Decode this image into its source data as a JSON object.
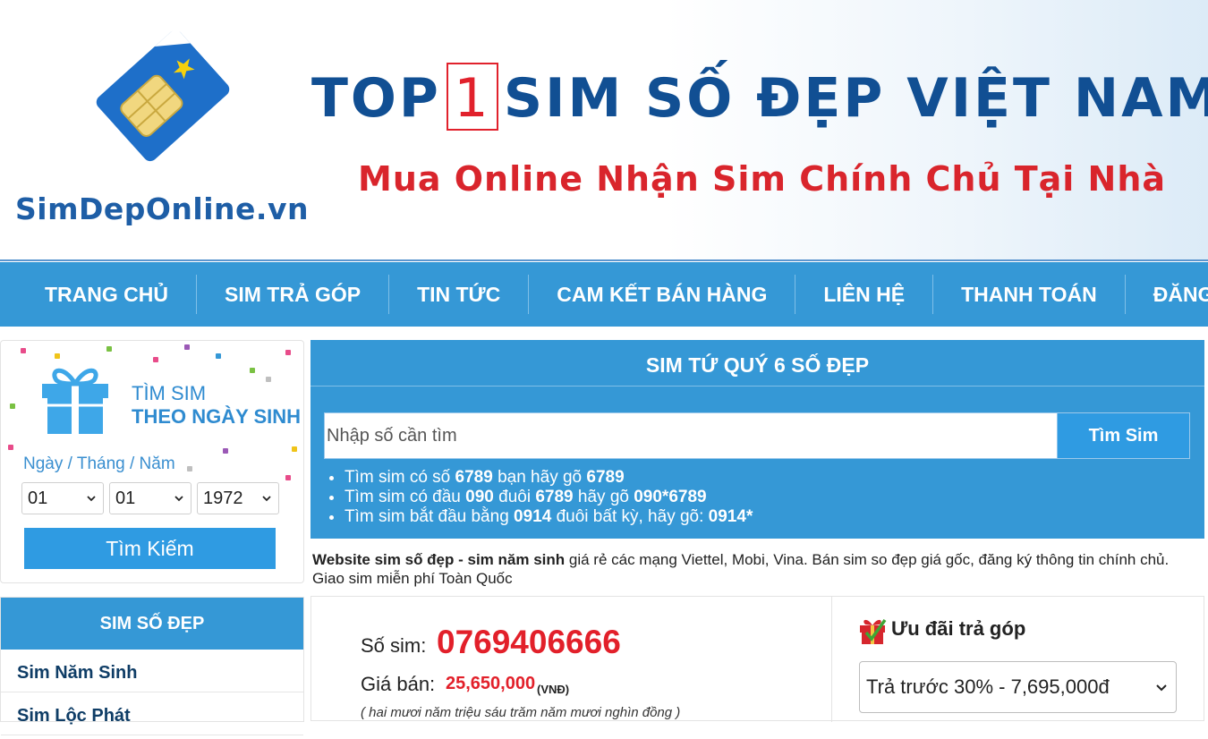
{
  "banner": {
    "site_name": "SimDepOnline.vn",
    "headline_before": "TOP",
    "headline_number": "1",
    "headline_after": "SIM SỐ ĐẸP VIỆT NAM",
    "tagline": "Mua Online Nhận Sim Chính Chủ Tại Nhà"
  },
  "nav": {
    "items": [
      "TRANG CHỦ",
      "SIM TRẢ GÓP",
      "TIN TỨC",
      "CAM KẾT BÁN HÀNG",
      "LIÊN HỆ",
      "THANH TOÁN",
      "ĐĂNG KÝ"
    ]
  },
  "birth_search": {
    "title_line1": "TÌM SIM",
    "title_line2": "THEO NGÀY SINH",
    "date_label": "Ngày / Tháng / Năm",
    "day": "01",
    "month": "01",
    "year": "1972",
    "button": "Tìm Kiếm"
  },
  "categories": {
    "heading": "SIM SỐ ĐẸP",
    "items": [
      "Sim Năm Sinh",
      "Sim Lộc Phát"
    ]
  },
  "main": {
    "title": "SIM TỨ QUÝ 6 SỐ ĐẸP",
    "search_placeholder": "Nhập số cần tìm",
    "search_button": "Tìm Sim",
    "tips": [
      {
        "a": "Tìm sim có số ",
        "b": "6789",
        "c": " bạn hãy gõ ",
        "d": "6789",
        "e": "",
        "f": "",
        "g": "",
        "h": ""
      },
      {
        "a": "Tìm sim có đầu ",
        "b": "090",
        "c": " đuôi ",
        "d": "6789",
        "e": " hãy gõ ",
        "f": "090*6789",
        "g": "",
        "h": ""
      },
      {
        "a": "Tìm sim bắt đầu bằng ",
        "b": "0914",
        "c": " đuôi bất kỳ, hãy gõ: ",
        "d": "0914*",
        "e": "",
        "f": "",
        "g": "",
        "h": ""
      }
    ],
    "intro_bold": "Website sim số đẹp - sim năm sinh",
    "intro_rest": " giá rẻ các mạng Viettel, Mobi, Vina. Bán sim so đẹp giá gốc, đăng ký thông tin chính chủ. Giao sim miễn phí Toàn Quốc"
  },
  "product": {
    "sim_label": "Số sim:",
    "sim_number": "0769406666",
    "price_label": "Giá bán:",
    "price_value": "25,650,000",
    "price_unit": "(VNĐ)",
    "price_words": "( hai mươi năm triệu sáu trăm năm mươi nghìn đồng )"
  },
  "installment": {
    "title": "Ưu đãi trả góp",
    "selected_option": "Trả trước 30% - 7,695,000đ"
  },
  "colors": {
    "primary_blue": "#3598d6",
    "button_blue": "#2f9be2",
    "price_red": "#e2202a",
    "logo_blue": "#1e5ea6"
  },
  "icons": {
    "sim_card": "sim-card-icon",
    "gift": "gift-icon",
    "chevron": "chevron-down-icon",
    "offer": "gift-offer-icon"
  }
}
